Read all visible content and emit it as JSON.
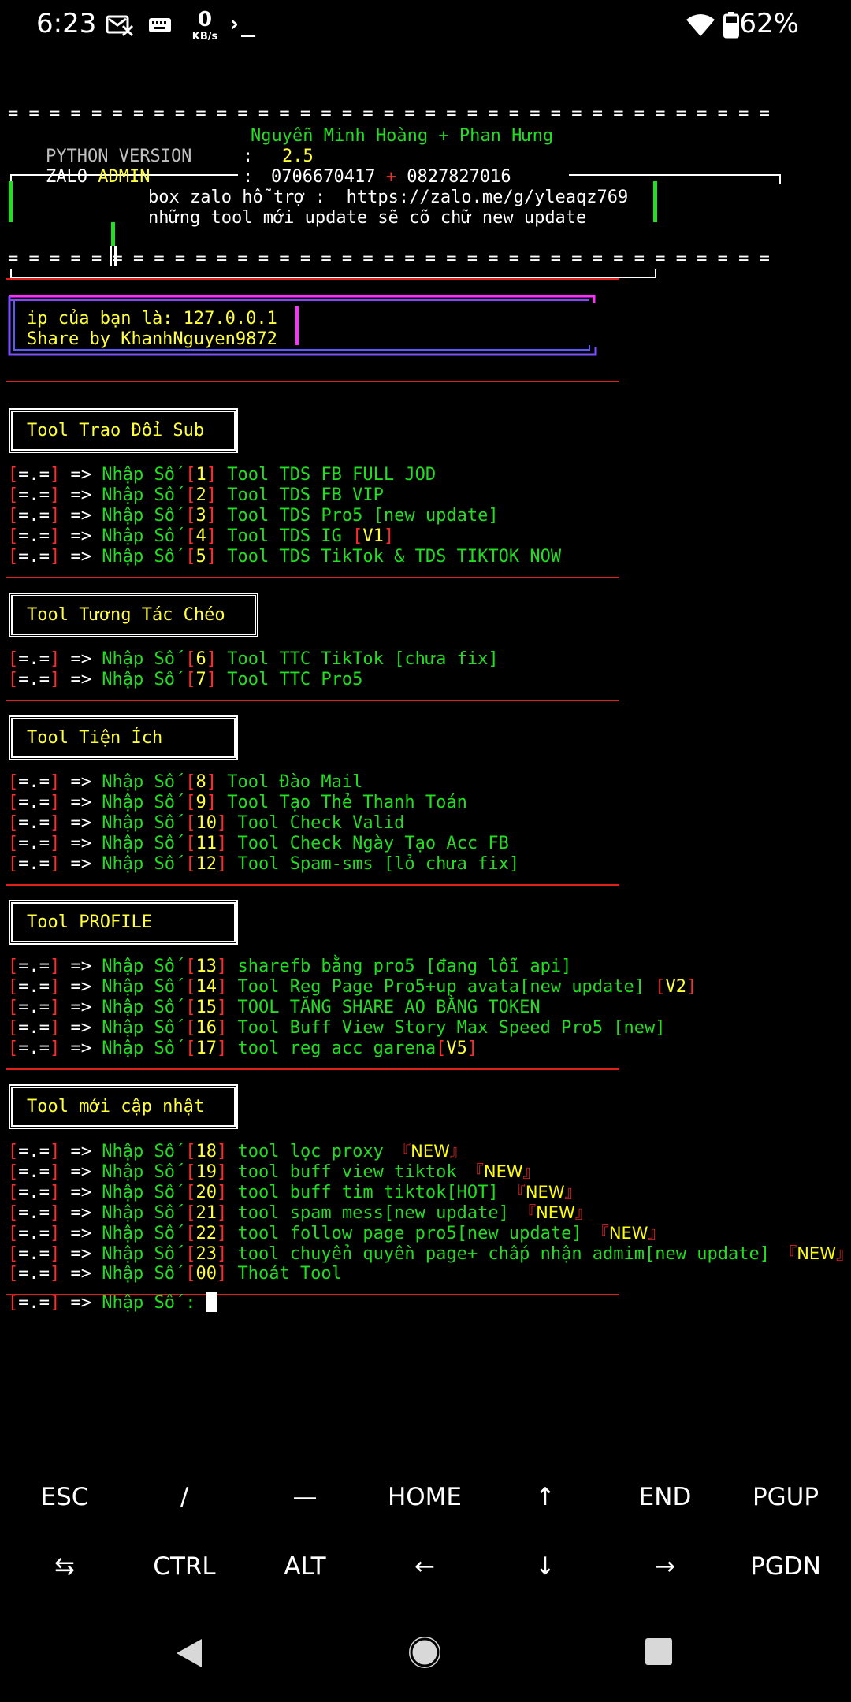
{
  "status_bar": {
    "time": "6:23",
    "net_speed_value": "0",
    "net_speed_unit": "KB/s",
    "shell_glyph": "›_",
    "battery": "62%"
  },
  "header": {
    "rule": "= = = = = = = = = = = = = = = = = = = = = = = = = = = = = = = = = = = = =",
    "authors": "Nguyễn Minh Hoàng + Phan Hưng",
    "python_label": "PYTHON VERSION",
    "python_sep": ":",
    "python_version": "2.5",
    "zalo_label": "ZALO",
    "zalo_admin": "ADMIN",
    "zalo_sep": ":",
    "phone1": "0706670417",
    "plus": "+",
    "phone2": "0827827016",
    "box_zalo": "box zalo hỗ trợ :  https://zalo.me/g/yleaqz769",
    "new_tool_note": "những tool mới update sẽ cõ chữ new update"
  },
  "ip_box": {
    "ip_line": "ip của bạn là: 127.0.0.1",
    "share_line": "Share by KhanhNguyen9872"
  },
  "menu": {
    "prefix_open": "[",
    "prefix_mid": "=.=",
    "prefix_close": "]",
    "arrow": "=>",
    "nhap_so": "Nhập Số"
  },
  "sections": [
    {
      "title": "Tool Trao Đổi Sub",
      "items": [
        {
          "num": "1",
          "label": "Tool TDS FB FULL JOD"
        },
        {
          "num": "2",
          "label": "Tool TDS FB VIP"
        },
        {
          "num": "3",
          "label": "Tool TDS Pro5 [new update]"
        },
        {
          "num": "4",
          "label": "Tool TDS IG ",
          "tag": "V1"
        },
        {
          "num": "5",
          "label": "Tool TDS TikTok & TDS TIKTOK NOW"
        }
      ]
    },
    {
      "title": "Tool Tương Tác Chéo",
      "items": [
        {
          "num": "6",
          "label": "Tool TTC TikTok [chưa fix]"
        },
        {
          "num": "7",
          "label": "Tool TTC Pro5"
        }
      ]
    },
    {
      "title": "Tool Tiện Ích",
      "items": [
        {
          "num": "8",
          "label": "Tool Đào Mail"
        },
        {
          "num": "9",
          "label": "Tool Tạo Thẻ Thanh Toán"
        },
        {
          "num": "10",
          "label": "Tool Check Valid"
        },
        {
          "num": "11",
          "label": "Tool Check Ngày Tạo Acc FB"
        },
        {
          "num": "12",
          "label": "Tool Spam-sms [lỏ chưa fix]"
        }
      ]
    },
    {
      "title": "Tool PROFILE",
      "items": [
        {
          "num": "13",
          "label": "sharefb bằng pro5 [đang lỗi api]"
        },
        {
          "num": "14",
          "label": "Tool Reg Page Pro5+up avata[new update] ",
          "tag": "V2"
        },
        {
          "num": "15",
          "label": "TOOL TĂNG SHARE AO BẰNG TOKEN"
        },
        {
          "num": "16",
          "label": "Tool Buff View Story Max Speed Pro5 [new]"
        },
        {
          "num": "17",
          "label": "tool reg acc garena",
          "tag": "V5"
        }
      ]
    },
    {
      "title": "Tool mới cập nhật",
      "items": [
        {
          "num": "18",
          "label": "tool lọc proxy ",
          "new": "NEW"
        },
        {
          "num": "19",
          "label": "tool buff view tiktok ",
          "new": "NEW"
        },
        {
          "num": "20",
          "label": "tool buff tim tiktok[HOT] ",
          "new": "NEW"
        },
        {
          "num": "21",
          "label": "tool spam mess[new update] ",
          "new": "NEW"
        },
        {
          "num": "22",
          "label": "tool follow page pro5[new update] ",
          "new": "NEW"
        },
        {
          "num": "23",
          "label": "tool chuyển quyền page+ chấp nhận admim[new update] ",
          "new": "NEW"
        },
        {
          "num": "00",
          "label": "Thoát Tool"
        }
      ]
    }
  ],
  "prompt": {
    "text": "Nhập Số :"
  },
  "extra_keys": {
    "row1": [
      "ESC",
      "/",
      "—",
      "HOME",
      "↑",
      "END",
      "PGUP"
    ],
    "row2": [
      "⇆",
      "CTRL",
      "ALT",
      "←",
      "↓",
      "→",
      "PGDN"
    ]
  },
  "colors": {
    "background": "#000000",
    "green": "#22dd22",
    "yellow": "#ffff3c",
    "red": "#ff2b2b",
    "rule_red": "#e0201d"
  }
}
